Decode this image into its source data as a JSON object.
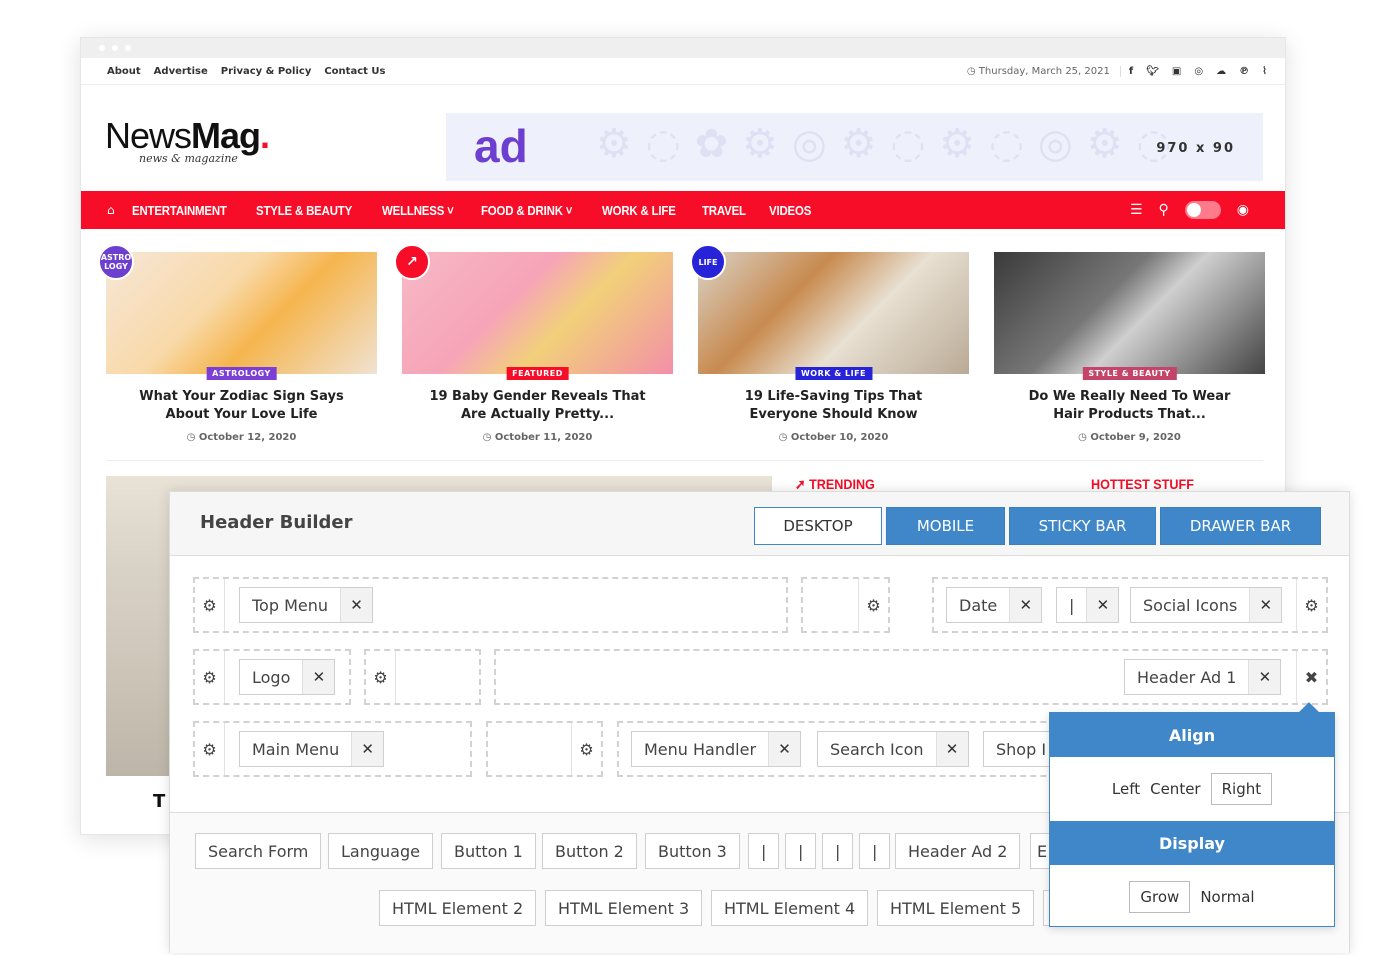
{
  "topbar": {
    "links": [
      "About",
      "Advertise",
      "Privacy & Policy",
      "Contact Us"
    ],
    "date": "Thursday, March 25, 2021",
    "social_icons": [
      "facebook-icon",
      "twitter-icon",
      "youtube-icon",
      "instagram-icon",
      "soundcloud-icon",
      "pinterest-icon",
      "rss-icon"
    ]
  },
  "brand": {
    "name_light": "News",
    "name_bold": "Mag",
    "dot": ".",
    "tagline": "news & magazine"
  },
  "ad": {
    "text": "ad",
    "size": "970 x 90"
  },
  "nav": {
    "items": [
      "ENTERTAINMENT",
      "STYLE & BEAUTY",
      "WELLNESS",
      "FOOD & DRINK",
      "WORK & LIFE",
      "TRAVEL",
      "VIDEOS"
    ],
    "accent": "#f70d28"
  },
  "cards": [
    {
      "badge": "ASTRO LOGY",
      "badge_color": "#6c3fd0",
      "category": "ASTROLOGY",
      "cat_color": "#7b3fd6",
      "title": "What Your Zodiac Sign Says About Your Love Life",
      "date": "October 12, 2020"
    },
    {
      "badge": "↗",
      "badge_color": "#f70d28",
      "category": "FEATURED",
      "cat_color": "#f70d28",
      "title": "19 Baby Gender Reveals That Are Actually Pretty...",
      "date": "October 11, 2020"
    },
    {
      "badge": "LIFE",
      "badge_color": "#2623d8",
      "category": "WORK & LIFE",
      "cat_color": "#2623d8",
      "title": "19 Life-Saving Tips That Everyone Should Know",
      "date": "October 10, 2020"
    },
    {
      "badge": "",
      "badge_color": "",
      "category": "STYLE & BEAUTY",
      "cat_color": "#c5446a",
      "title": "Do We Really Need To Wear Hair Products That...",
      "date": "October 9, 2020"
    }
  ],
  "sections": {
    "trending": "TRENDING",
    "hottest": "HOTTEST STUFF",
    "featured_title_fragment": "T"
  },
  "builder": {
    "title": "Header Builder",
    "tabs": [
      "DESKTOP",
      "MOBILE",
      "STICKY BAR",
      "DRAWER BAR"
    ],
    "active_tab": "DESKTOP",
    "tab_color": "#3f87c8",
    "row1": {
      "left": [
        "Top Menu"
      ],
      "right": [
        "Date",
        "|",
        "Social Icons"
      ]
    },
    "row2": {
      "left": [
        "Logo"
      ],
      "right": [
        "Header Ad 1"
      ]
    },
    "row3": {
      "left": [
        "Main Menu"
      ],
      "right": [
        "Menu Handler",
        "Search Icon",
        "Shop I"
      ]
    },
    "tray_row1": [
      "Search Form",
      "Language",
      "Button 1",
      "Button 2",
      "Button 3",
      "|",
      "|",
      "|",
      "|",
      "Header Ad 2",
      "E"
    ],
    "tray_row2": [
      "HTML Element 2",
      "HTML Element 3",
      "HTML Element 4",
      "HTML Element 5"
    ],
    "popup": {
      "align_label": "Align",
      "align_options": [
        "Left",
        "Center",
        "Right"
      ],
      "align_selected": "Right",
      "display_label": "Display",
      "display_options": [
        "Grow",
        "Normal"
      ],
      "display_selected": "Grow"
    }
  }
}
